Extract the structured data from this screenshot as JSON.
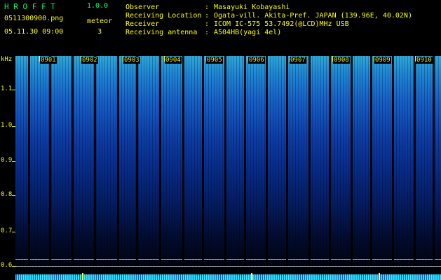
{
  "header": {
    "app_title": "H R O F F T",
    "version": "1.0.0",
    "filename": "0511300900.png",
    "datetime": "05.11.30 09:00",
    "meteor_label": "meteor",
    "meteor_count": "3",
    "info": [
      {
        "key": "Observer",
        "value": "Masayuki Kobayashi"
      },
      {
        "key": "Receiving Location",
        "value": "Ogata-vill. Akita-Pref. JAPAN (139.96E, 40.02N)"
      },
      {
        "key": "Receiver",
        "value": "ICOM IC-575 53.7492(@LCD)MHz USB"
      },
      {
        "key": "Receiving antenna",
        "value": "A504HB(yagi 4el)"
      }
    ]
  },
  "spectrogram": {
    "freq_unit": "kHz",
    "freq_labels": [
      "1.1",
      "1.0",
      "0.9",
      "0.8",
      "0.7",
      "0.6"
    ],
    "minute_labels": [
      "0901",
      "0902",
      "0903",
      "0904",
      "0905",
      "0906",
      "0907",
      "0908",
      "0909",
      "0910"
    ]
  }
}
